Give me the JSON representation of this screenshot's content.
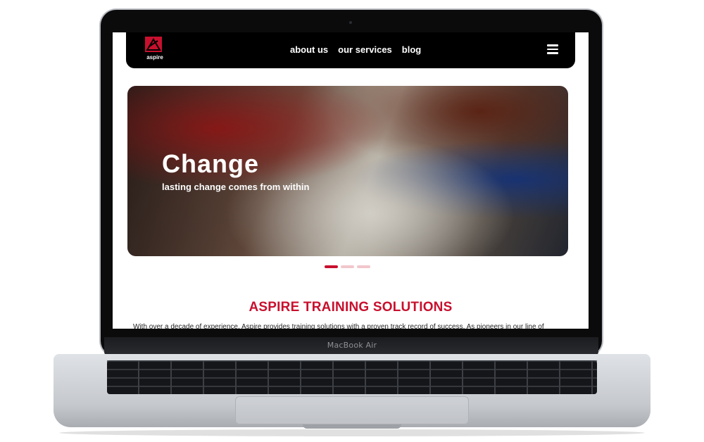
{
  "device": {
    "label": "MacBook Air"
  },
  "site": {
    "logo_text": "aspire",
    "nav": [
      {
        "label": "about us"
      },
      {
        "label": "our services"
      },
      {
        "label": "blog"
      }
    ],
    "menu_icon": "hamburger-menu-icon"
  },
  "hero": {
    "title": "Change",
    "subtitle": "lasting change comes from within",
    "slides": 3,
    "active_slide": 1
  },
  "section": {
    "title": "ASPIRE TRAINING SOLUTIONS",
    "text": "With over a decade of experience, Aspire provides training solutions with a proven track record of success. As pioneers in our line of"
  },
  "colors": {
    "accent": "#c8102e",
    "navbar": "#000000",
    "dot_inactive": "#f2c6cc"
  }
}
